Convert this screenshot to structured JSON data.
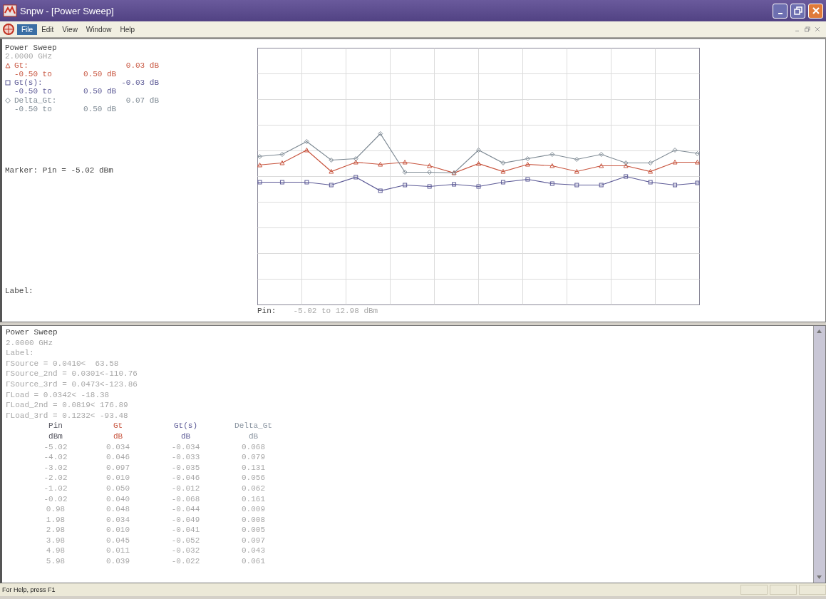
{
  "window": {
    "title": "Snpw - [Power Sweep]"
  },
  "menu": [
    {
      "label": "File",
      "selected": true
    },
    {
      "label": "Edit",
      "selected": false
    },
    {
      "label": "View",
      "selected": false
    },
    {
      "label": "Window",
      "selected": false
    },
    {
      "label": "Help",
      "selected": false
    }
  ],
  "graph_pane": {
    "title": "Power Sweep",
    "frequency": "2.0000 GHz",
    "traces": [
      {
        "kind": "triangle",
        "name": "Gt:",
        "value": "0.03 dB",
        "range_low": "-0.50 to",
        "range_high": "0.50 dB",
        "color": "#c8553f"
      },
      {
        "kind": "square",
        "name": "Gt(s):",
        "value": "-0.03 dB",
        "range_low": "-0.50 to",
        "range_high": "0.50 dB",
        "color": "#5c5a96"
      },
      {
        "kind": "diamond",
        "name": "Delta_Gt:",
        "value": "0.07 dB",
        "range_low": "-0.50 to",
        "range_high": "0.50 dB",
        "color": "#7e8a94"
      }
    ],
    "marker": "Marker: Pin = -5.02 dBm",
    "label": "Label:",
    "x_axis_name": "Pin:",
    "x_axis_range": "-5.02 to 12.98 dBm"
  },
  "listing_pane": {
    "title": "Power Sweep",
    "frequency": "2.0000 GHz",
    "label": "Label:",
    "lines": [
      "ΓSource = 0.0410<  63.58",
      "ΓSource_2nd = 0.0301<-110.76",
      "ΓSource_3rd = 0.0473<-123.86",
      "ΓLoad = 0.0342< -18.38",
      "ΓLoad_2nd = 0.0819< 176.89",
      "ΓLoad_3rd = 0.1232< -93.48"
    ],
    "table": {
      "columns": [
        {
          "name": "Pin",
          "unit": "dBm",
          "color": "#55555f"
        },
        {
          "name": "Gt",
          "unit": "dB",
          "color": "#c8553f"
        },
        {
          "name": "Gt(s)",
          "unit": "dB",
          "color": "#5c5a96"
        },
        {
          "name": "Delta_Gt",
          "unit": "dB",
          "color": "#8a94a0"
        }
      ],
      "rows": [
        [
          "-5.02",
          "0.034",
          "-0.034",
          "0.068"
        ],
        [
          "-4.02",
          "0.046",
          "-0.033",
          "0.079"
        ],
        [
          "-3.02",
          "0.097",
          "-0.035",
          "0.131"
        ],
        [
          "-2.02",
          "0.010",
          "-0.046",
          "0.056"
        ],
        [
          "-1.02",
          "0.050",
          "-0.012",
          "0.062"
        ],
        [
          "-0.02",
          "0.040",
          "-0.068",
          "0.161"
        ],
        [
          "0.98",
          "0.048",
          "-0.044",
          "0.009"
        ],
        [
          "1.98",
          "0.034",
          "-0.049",
          "0.008"
        ],
        [
          "2.98",
          "0.010",
          "-0.041",
          "0.005"
        ],
        [
          "3.98",
          "0.045",
          "-0.052",
          "0.097"
        ],
        [
          "4.98",
          "0.011",
          "-0.032",
          "0.043"
        ],
        [
          "5.98",
          "0.039",
          "-0.022",
          "0.061"
        ]
      ]
    }
  },
  "status_bar": {
    "text": "For Help, press F1"
  }
}
